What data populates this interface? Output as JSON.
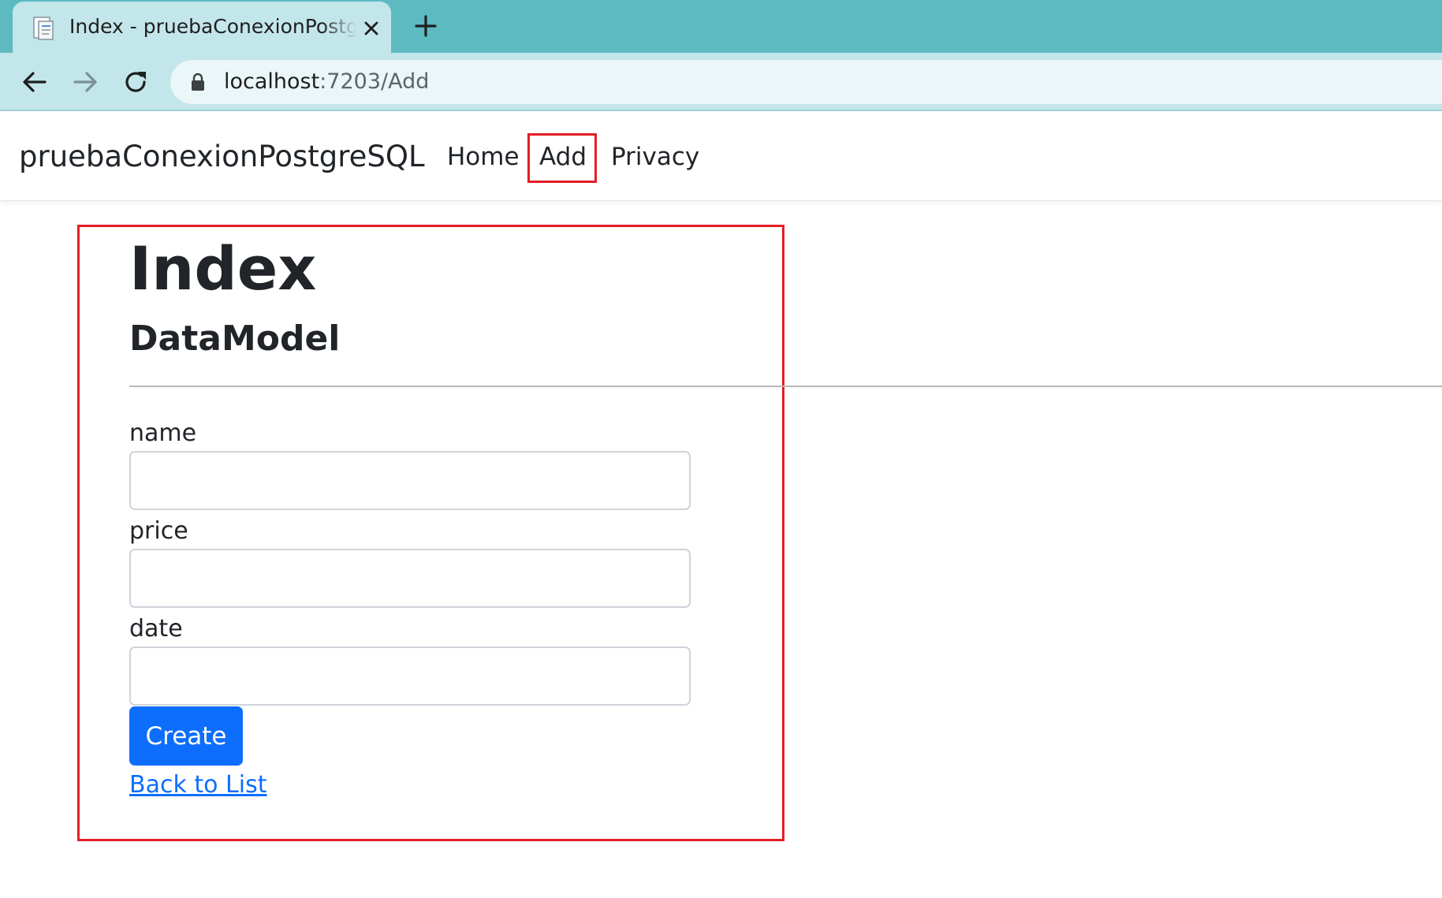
{
  "browser": {
    "tab_title": "Index - pruebaConexionPostgreSQL",
    "url_host": "localhost",
    "url_path": ":7203/Add"
  },
  "navbar": {
    "brand": "pruebaConexionPostgreSQL",
    "links": [
      {
        "label": "Home"
      },
      {
        "label": "Add"
      },
      {
        "label": "Privacy"
      }
    ]
  },
  "page": {
    "title": "Index",
    "subtitle": "DataModel",
    "fields": [
      {
        "label": "name",
        "value": ""
      },
      {
        "label": "price",
        "value": ""
      },
      {
        "label": "date",
        "value": ""
      }
    ],
    "submit_label": "Create",
    "back_link": "Back to List"
  },
  "colors": {
    "tabstrip": "#5dbac1",
    "toolbar": "#c3e6ea",
    "primary": "#0d6efd",
    "highlight": "#e41e26"
  },
  "icons": [
    "page-favicon-icon",
    "close-icon",
    "plus-icon",
    "back-arrow-icon",
    "forward-arrow-icon",
    "reload-icon",
    "lock-icon"
  ]
}
